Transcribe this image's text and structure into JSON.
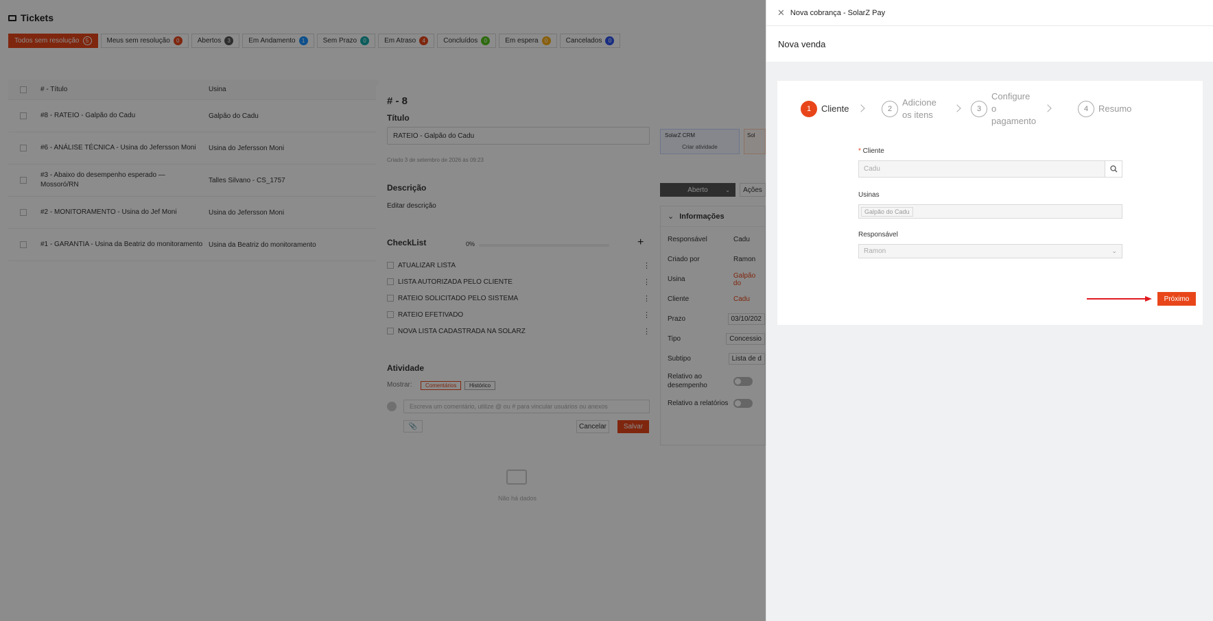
{
  "page": {
    "title": "Tickets"
  },
  "tabs": [
    {
      "label": "Todos sem resolução",
      "count": "5",
      "color": "#e8461a",
      "active": true
    },
    {
      "label": "Meus sem resolução",
      "count": "0",
      "color": "#e8461a"
    },
    {
      "label": "Abertos",
      "count": "3",
      "color": "#555"
    },
    {
      "label": "Em Andamento",
      "count": "1",
      "color": "#1890ff"
    },
    {
      "label": "Sem Prazo",
      "count": "0",
      "color": "#13a8a8"
    },
    {
      "label": "Em Atraso",
      "count": "4",
      "color": "#e8461a"
    },
    {
      "label": "Concluídos",
      "count": "0",
      "color": "#52c41a"
    },
    {
      "label": "Em espera",
      "count": "0",
      "color": "#faad14"
    },
    {
      "label": "Cancelados",
      "count": "0",
      "color": "#2f54eb"
    }
  ],
  "table": {
    "headers": {
      "title": "# - Título",
      "usina": "Usina"
    },
    "rows": [
      {
        "title": "#8 - RATEIO - Galpão do Cadu",
        "usina": "Galpão do Cadu"
      },
      {
        "title": "#6 - ANÁLISE TÉCNICA - Usina do Jefersson Moni",
        "usina": "Usina do Jefersson Moni"
      },
      {
        "title": "#3 - Abaixo do desempenho esperado — Mossoró/RN",
        "usina": "Talles Silvano - CS_1757"
      },
      {
        "title": "#2 - MONITORAMENTO - Usina do Jef Moni",
        "usina": "Usina do Jefersson Moni"
      },
      {
        "title": "#1 - GARANTIA - Usina da Beatriz do monitoramento",
        "usina": "Usina da Beatriz do monitoramento"
      }
    ]
  },
  "ticket": {
    "number": "# - 8",
    "title_label": "Título",
    "title_value": "RATEIO - Galpão do Cadu",
    "created": "Criado 3 de setembro de 2026 às 09:23",
    "crm_label": "SolarZ CRM",
    "crm_action": "Criar atividade",
    "sol_label": "Sol",
    "description_label": "Descrição",
    "edit_description": "Editar descrição",
    "checklist_label": "CheckList",
    "checklist_percent": "0%",
    "checklist_progress": 0,
    "checklist": [
      "ATUALIZAR LISTA",
      "LISTA AUTORIZADA PELO CLIENTE",
      "RATEIO SOLICITADO PELO SISTEMA",
      "RATEIO EFETIVADO",
      "NOVA LISTA CADASTRADA NA SOLARZ"
    ],
    "activity_label": "Atividade",
    "show_label": "Mostrar:",
    "show_comments": "Comentários",
    "show_history": "Histórico",
    "comment_placeholder": "Escreva um comentário, utilize @ ou # para vincular usuários ou anexos",
    "cancel": "Cancelar",
    "save": "Salvar",
    "empty": "Não há dados",
    "status": "Aberto",
    "actions": "Ações",
    "info_label": "Informações",
    "info": [
      {
        "key": "Responsável",
        "value": "Cadu"
      },
      {
        "key": "Criado por",
        "value": "Ramon"
      },
      {
        "key": "Usina",
        "value": "Galpão do"
      },
      {
        "key": "Cliente",
        "value": "Cadu"
      },
      {
        "key": "Prazo",
        "value": "03/10/202"
      },
      {
        "key": "Tipo",
        "value": "Concessio"
      },
      {
        "key": "Subtipo",
        "value": "Lista de d"
      },
      {
        "key": "Relativo ao desempenho",
        "value": ""
      },
      {
        "key": "Relativo a relatórios",
        "value": ""
      }
    ]
  },
  "drawer": {
    "title": "Nova cobrança - SolarZ Pay",
    "subtitle": "Nova venda",
    "steps": [
      {
        "n": "1",
        "label": "Cliente"
      },
      {
        "n": "2",
        "label": "Adicione os itens"
      },
      {
        "n": "3",
        "label": "Configure o pagamento"
      },
      {
        "n": "4",
        "label": "Resumo"
      }
    ],
    "cliente_label": "Cliente",
    "cliente_value": "Cadu",
    "usinas_label": "Usinas",
    "usinas_tag": "Galpão do Cadu",
    "responsavel_label": "Responsável",
    "responsavel_value": "Ramon",
    "next_button": "Próximo"
  },
  "colors": {
    "accent": "#e8461a",
    "arrow": "#e0191f"
  }
}
